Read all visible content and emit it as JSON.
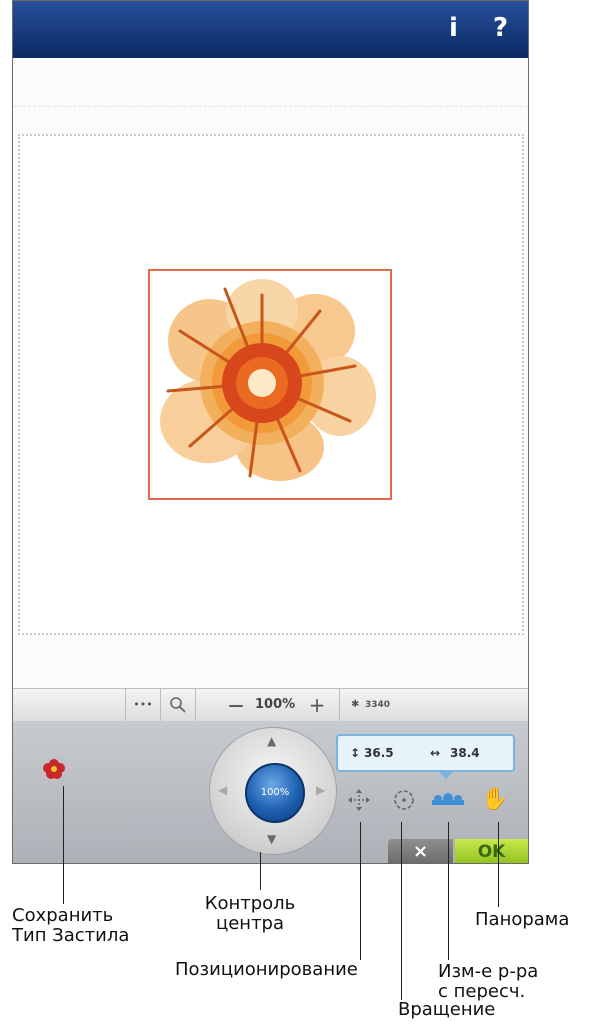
{
  "titlebar": {
    "info_icon": "info-icon",
    "info_label": "i",
    "help_icon": "help-icon",
    "help_label": "?"
  },
  "toolbar": {
    "more_label": "•••",
    "zoom_icon": "magnifier-icon",
    "zoom_out_label": "—",
    "zoom_value": "100%",
    "zoom_in_label": "+",
    "stitch_count": "3340"
  },
  "panel": {
    "wheel_value": "100%",
    "height_value": "36.5",
    "width_value": "38.4",
    "cancel_label": "×",
    "ok_label": "OK"
  },
  "callouts": {
    "save_stabilizer_line1": "Сохранить",
    "save_stabilizer_line2": "Тип Застила",
    "center_control_line1": "Контроль",
    "center_control_line2": "центра",
    "positioning": "Позиционирование",
    "panorama": "Панорама",
    "resize_line1": "Изм-е р-ра",
    "resize_line2": "с пересч.",
    "rotation": "Вращение"
  },
  "colors": {
    "titlebar": "#113574",
    "design_frame": "#e06a4a",
    "ok_button": "#8ebf1e",
    "wheel_center": "#1d5fb0"
  }
}
